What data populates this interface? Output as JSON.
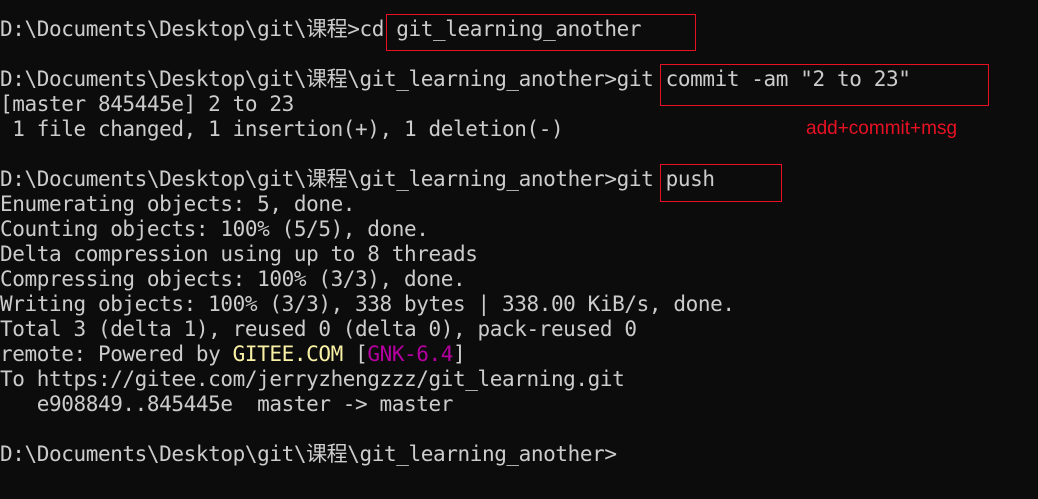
{
  "terminal": {
    "lines": [
      {
        "prompt": "D:\\Documents\\Desktop\\git\\课程>",
        "command": "cd git_learning_another"
      },
      {
        "text": ""
      },
      {
        "prompt": "D:\\Documents\\Desktop\\git\\课程\\git_learning_another>",
        "command": "git commit -am \"2 to 23\""
      },
      {
        "text": "[master 845445e] 2 to 23"
      },
      {
        "text": " 1 file changed, 1 insertion(+), 1 deletion(-)"
      },
      {
        "text": ""
      },
      {
        "prompt": "D:\\Documents\\Desktop\\git\\课程\\git_learning_another>",
        "command": "git push"
      },
      {
        "text": "Enumerating objects: 5, done."
      },
      {
        "text": "Counting objects: 100% (5/5), done."
      },
      {
        "text": "Delta compression using up to 8 threads"
      },
      {
        "text": "Compressing objects: 100% (3/3), done."
      },
      {
        "text": "Writing objects: 100% (3/3), 338 bytes | 338.00 KiB/s, done."
      },
      {
        "text": "Total 3 (delta 1), reused 0 (delta 0), pack-reused 0"
      },
      {
        "remote_prefix": "remote: Powered by ",
        "remote_host": "GITEE.COM",
        "remote_open": " [",
        "remote_tag": "GNK-6.4",
        "remote_close": "]"
      },
      {
        "text": "To https://gitee.com/jerryzhengzzz/git_learning.git"
      },
      {
        "text": "   e908849..845445e  master -> master"
      },
      {
        "text": ""
      },
      {
        "prompt": "D:\\Documents\\Desktop\\git\\课程\\git_learning_another>",
        "command": ""
      }
    ]
  },
  "annotation": {
    "label": "add+commit+msg"
  },
  "colors": {
    "background": "#0c0c0c",
    "text": "#cccccc",
    "highlight_box": "#e81123",
    "remote_host": "#f9f1a5",
    "remote_tag": "#b4009e"
  }
}
